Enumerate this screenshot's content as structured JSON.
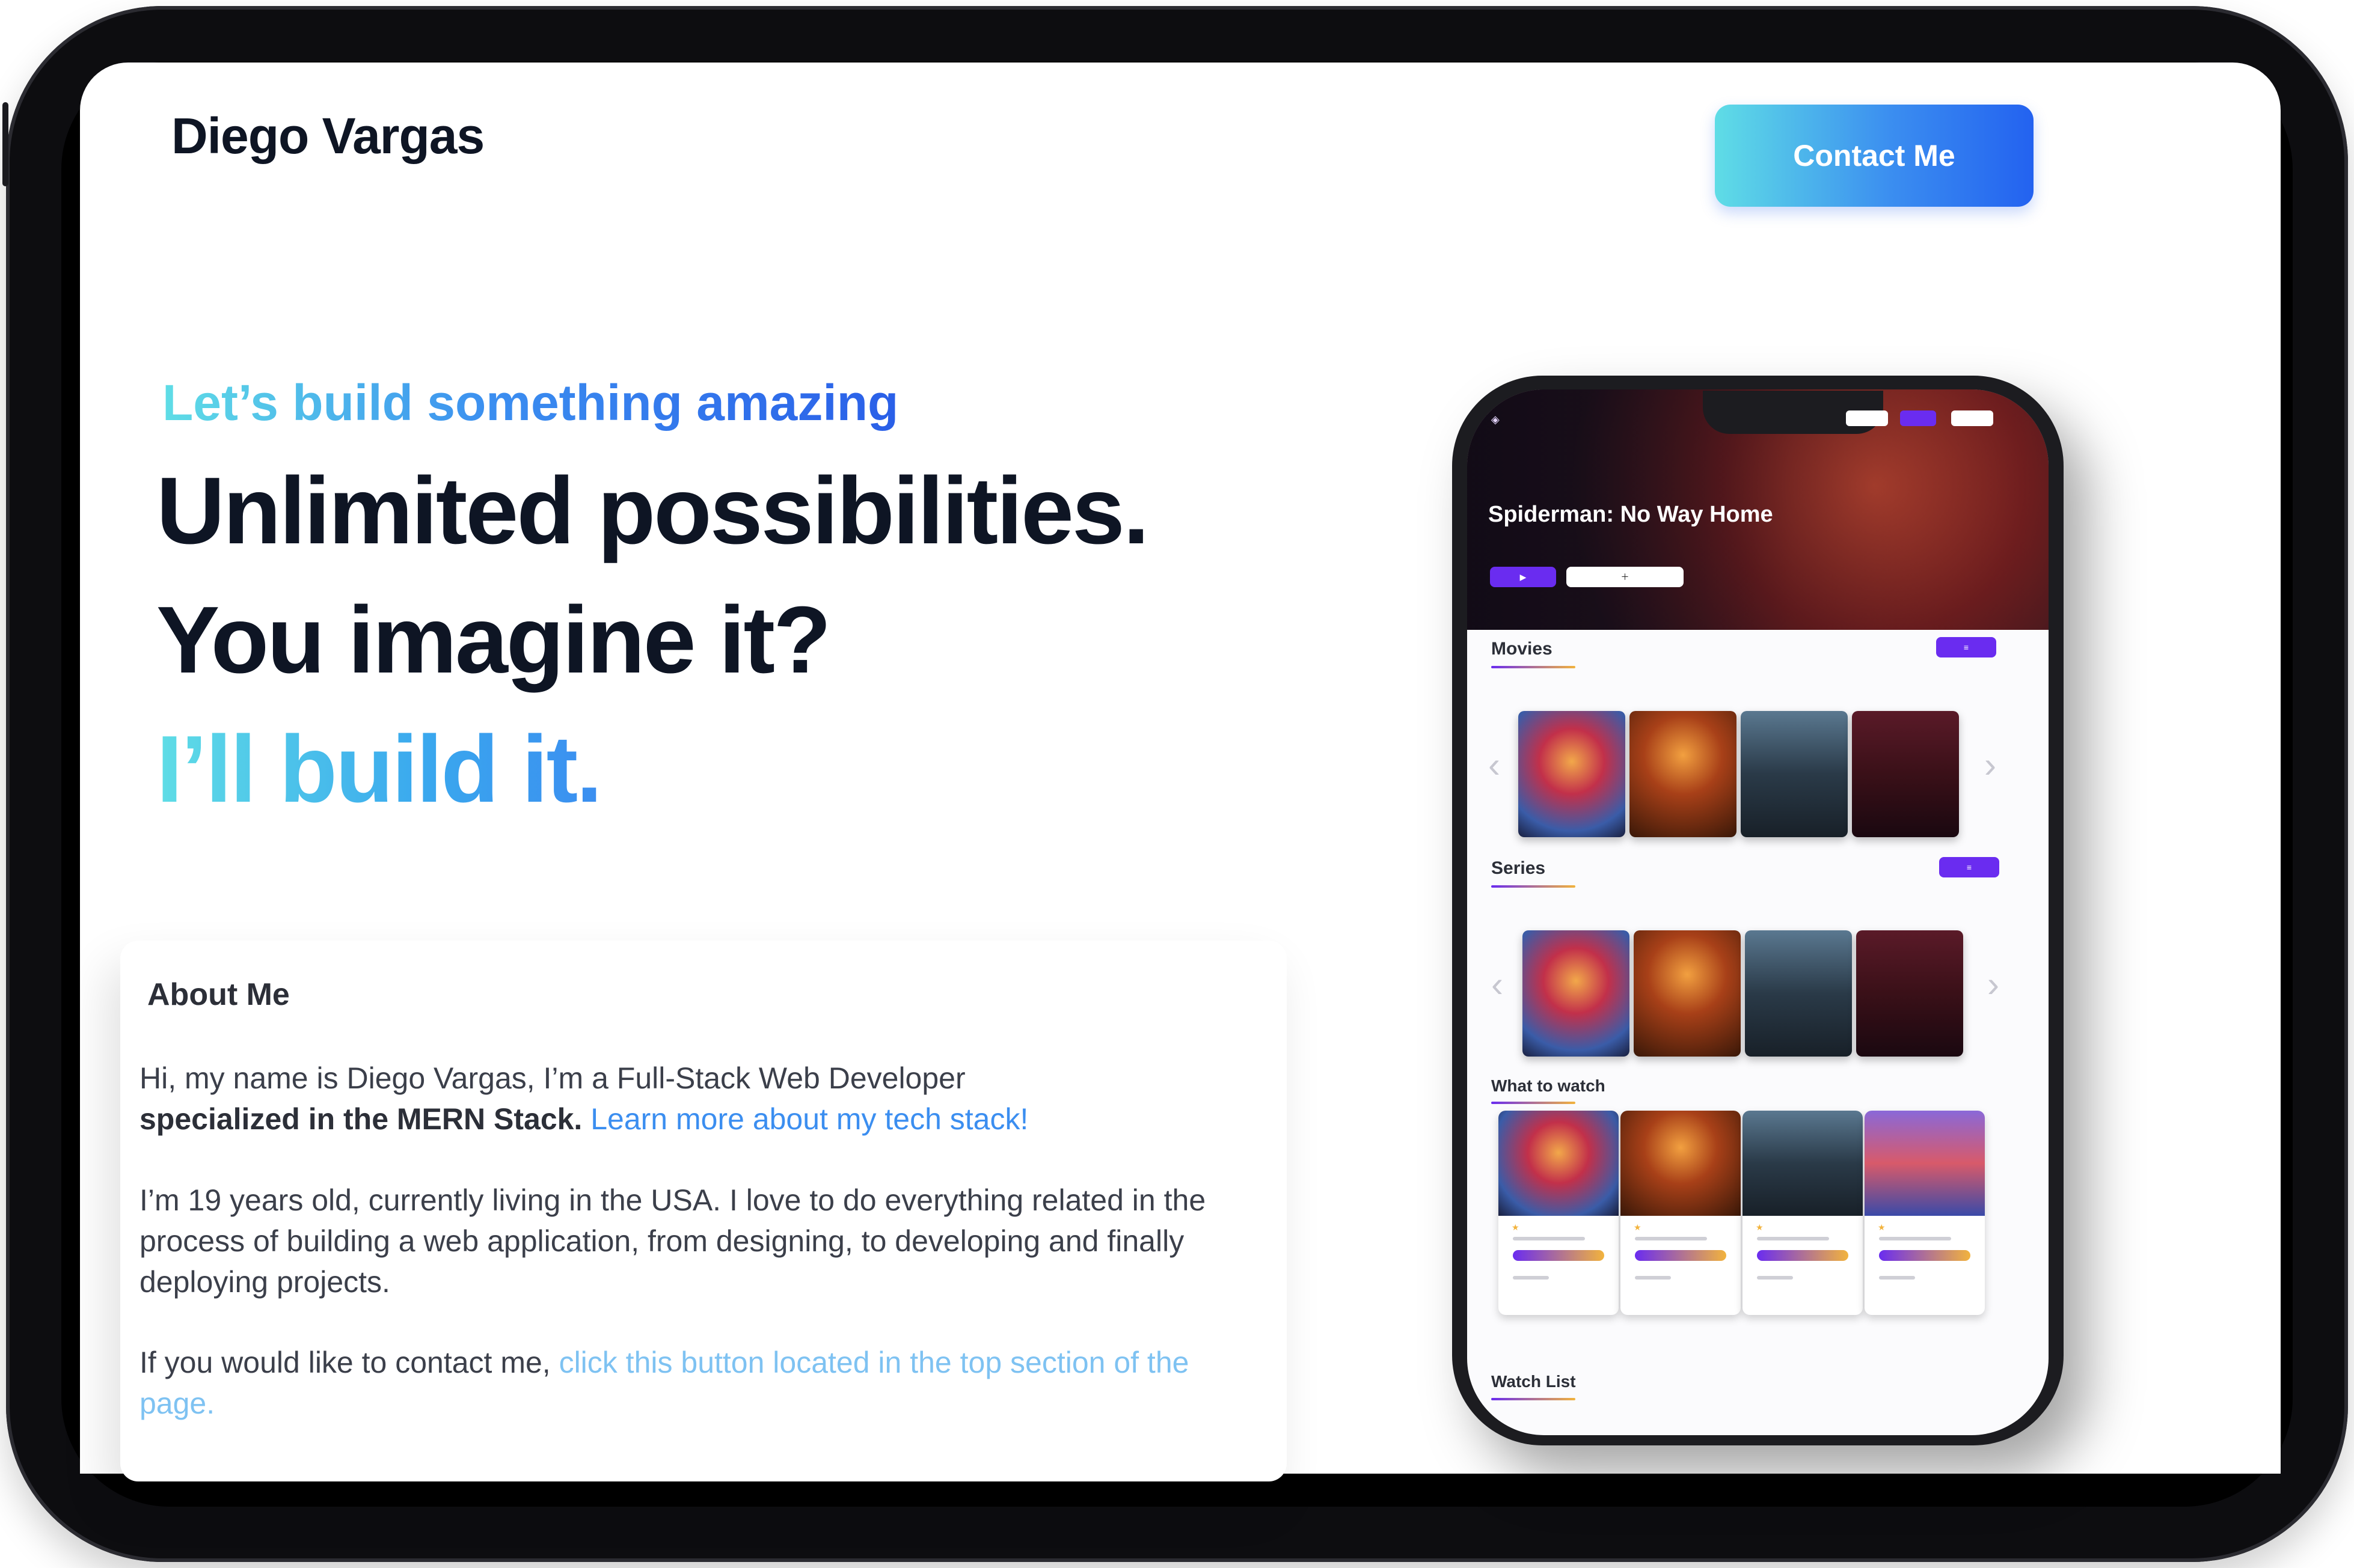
{
  "header": {
    "brand": "Diego Vargas",
    "contact_button": "Contact Me"
  },
  "hero": {
    "tagline": "Let’s build something amazing",
    "line1": "Unlimited possibilities.",
    "line2": "You imagine it?",
    "line3": "I’ll build it."
  },
  "about": {
    "title": "About Me",
    "p1_plain": "Hi, my name is Diego Vargas, I’m a Full-Stack Web Developer",
    "p1_bold": "specialized in the MERN Stack.",
    "p1_link": "Learn more about my  tech stack!",
    "p2": "I’m 19 years old, currently living in the USA.  I love to do everything related in the process of building a web application, from designing, to developing and finally deploying projects.",
    "p3_plain": "If you would like to contact me,",
    "p3_link": "click this button located in the top section of the page."
  },
  "phone_app": {
    "hero_title": "Spiderman: No Way Home",
    "sections": {
      "movies": "Movies",
      "series": "Series",
      "what_to_watch": "What to watch",
      "watch_list": "Watch List"
    }
  },
  "colors": {
    "dark_text": "#0e1524",
    "accent_cyan": "#5fdde6",
    "accent_blue": "#3b8ef0",
    "app_purple": "#6a2cf0"
  }
}
